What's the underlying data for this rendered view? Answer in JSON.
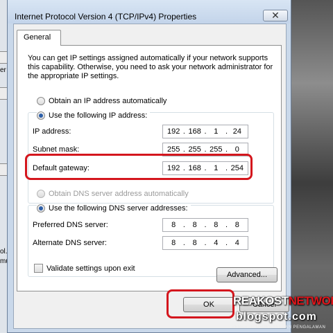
{
  "window": {
    "title": "Internet Protocol Version 4 (TCP/IPv4) Properties",
    "close_glyph": "✕"
  },
  "tabs": [
    {
      "label": "General"
    }
  ],
  "description": "You can get IP settings assigned automatically if your network supports this capability. Otherwise, you need to ask your network administrator for the appropriate IP settings.",
  "ip_section": {
    "auto_label": "Obtain an IP address automatically",
    "manual_label": "Use the following IP address:",
    "selected": "manual",
    "fields": [
      {
        "label": "IP address:",
        "octets": [
          "192",
          "168",
          "1",
          "24"
        ]
      },
      {
        "label": "Subnet mask:",
        "octets": [
          "255",
          "255",
          "255",
          "0"
        ]
      },
      {
        "label": "Default gateway:",
        "octets": [
          "192",
          "168",
          "1",
          "254"
        ]
      }
    ]
  },
  "dns_section": {
    "auto_label": "Obtain DNS server address automatically",
    "manual_label": "Use the following DNS server addresses:",
    "selected": "manual",
    "fields": [
      {
        "label": "Preferred DNS server:",
        "octets": [
          "8",
          "8",
          "8",
          "8"
        ]
      },
      {
        "label": "Alternate DNS server:",
        "octets": [
          "8",
          "8",
          "4",
          "4"
        ]
      }
    ]
  },
  "validate_label": "Validate settings upon exit",
  "advanced_label": "Advanced...",
  "ok_label": "OK",
  "cancel_label": "Cancel",
  "colors": {
    "highlight": "#d4161d",
    "title_bar": "#c9d8ea",
    "radio_dot": "#2d5fa8"
  },
  "background_fragments": [
    "er",
    "ol.",
    "mu"
  ],
  "watermark": {
    "line1_white": "REAKOST",
    "line1_red": "NETWORK",
    "line2": "blogspot.com",
    "tagline": "BERBAGI INFORMASI DAN PENGALAMAN"
  }
}
